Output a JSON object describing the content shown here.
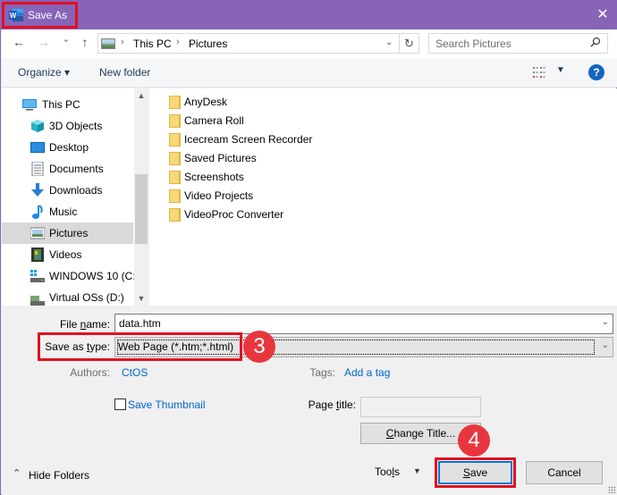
{
  "window": {
    "title": "Save As",
    "close_label": "✕"
  },
  "nav": {
    "back_icon": "←",
    "forward_icon": "→",
    "recent_icon": "⌄",
    "up_icon": "↑",
    "breadcrumb": [
      "This PC",
      "Pictures"
    ],
    "refresh_icon": "↻",
    "search_placeholder": "Search Pictures",
    "search_icon": "⚲"
  },
  "toolbar": {
    "organize_label": "Organize ▾",
    "new_folder_label": "New folder",
    "view_dd": "▼",
    "help_label": "?"
  },
  "sidebar": {
    "items": [
      {
        "label": "This PC",
        "icon": "computer-icon"
      },
      {
        "label": "3D Objects",
        "icon": "3d-objects-icon"
      },
      {
        "label": "Desktop",
        "icon": "desktop-icon"
      },
      {
        "label": "Documents",
        "icon": "documents-icon"
      },
      {
        "label": "Downloads",
        "icon": "downloads-icon"
      },
      {
        "label": "Music",
        "icon": "music-icon"
      },
      {
        "label": "Pictures",
        "icon": "pictures-icon",
        "selected": true
      },
      {
        "label": "Videos",
        "icon": "videos-icon"
      },
      {
        "label": "WINDOWS 10 (C:)",
        "icon": "drive-icon"
      },
      {
        "label": "Virtual OSs (D:)",
        "icon": "drive-icon"
      }
    ],
    "scroll_up": "⌃",
    "scroll_down": "⌄"
  },
  "folders": [
    "AnyDesk",
    "Camera Roll",
    "Icecream Screen Recorder",
    "Saved Pictures",
    "Screenshots",
    "Video Projects",
    "VideoProc Converter"
  ],
  "form": {
    "file_name_label_pre": "File ",
    "file_name_label_u": "n",
    "file_name_label_post": "ame:",
    "file_name_value": "data.htm",
    "save_type_label_pre": "Save as ",
    "save_type_label_u": "t",
    "save_type_label_post": "ype:",
    "save_type_value": "Web Page (*.htm;*.html)",
    "authors_label": "Authors:",
    "authors_value": "CtOS",
    "tags_label": "Tags:",
    "tags_value": "Add a tag",
    "save_thumbnail_label": "Save Thumbnail",
    "page_title_label_pre": "Page ",
    "page_title_label_u": "t",
    "page_title_label_post": "itle:",
    "page_title_value": "",
    "change_title_u": "C",
    "change_title_rest": "hange Title...",
    "dropdown_icon": "⌄"
  },
  "footer": {
    "hide_folders_label": "Hide Folders",
    "hide_folders_icon": "^",
    "tools_pre": "Too",
    "tools_u": "l",
    "tools_post": "s",
    "tools_dd": "▼",
    "save_u": "S",
    "save_rest": "ave",
    "cancel_label": "Cancel"
  },
  "annotations": {
    "step3": "3",
    "step4": "4"
  },
  "colors": {
    "titlebar": "#8764b8",
    "highlight_red": "#e01020",
    "badge_red": "#e8363f",
    "link_blue": "#0066cc",
    "default_button_border": "#0078d7"
  }
}
